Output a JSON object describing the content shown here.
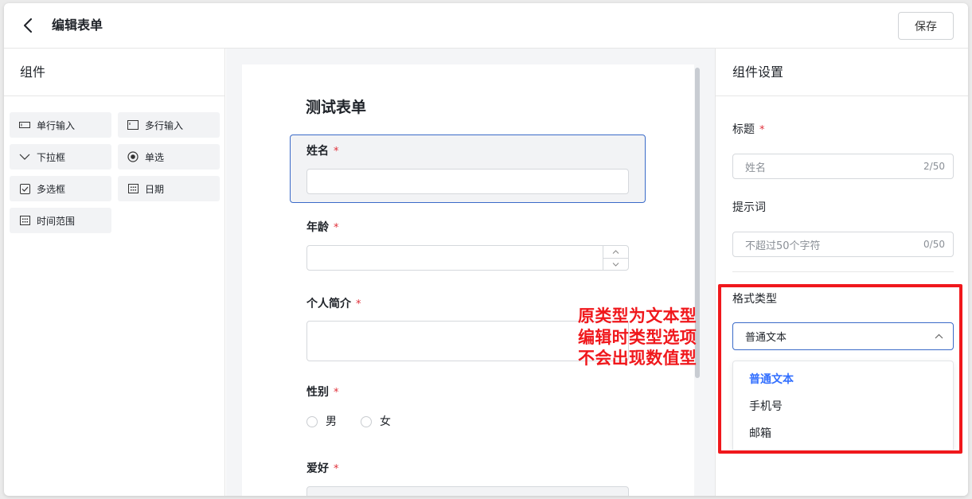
{
  "header": {
    "back_icon": "chevron-left-icon",
    "title": "编辑表单",
    "save_label": "保存"
  },
  "left_panel": {
    "title": "组件",
    "components": [
      {
        "label": "单行输入",
        "icon": "single-line-input-icon"
      },
      {
        "label": "多行输入",
        "icon": "multi-line-input-icon"
      },
      {
        "label": "下拉框",
        "icon": "chevron-down-icon"
      },
      {
        "label": "单选",
        "icon": "radio-icon"
      },
      {
        "label": "多选框",
        "icon": "checkbox-icon"
      },
      {
        "label": "日期",
        "icon": "calendar-icon"
      },
      {
        "label": "时间范围",
        "icon": "calendar-icon"
      }
    ]
  },
  "form": {
    "title": "测试表单",
    "fields": [
      {
        "label": "姓名",
        "required": "*"
      },
      {
        "label": "年龄",
        "required": "*"
      },
      {
        "label": "个人简介",
        "required": "*"
      },
      {
        "label": "性别",
        "required": "*",
        "options": [
          "男",
          "女"
        ]
      },
      {
        "label": "爱好",
        "required": "*"
      }
    ]
  },
  "annotation": {
    "lines": [
      "原类型为文本型",
      "编辑时类型选项",
      "不会出现数值型"
    ],
    "color": "#f0181c"
  },
  "settings": {
    "title": "组件设置",
    "title_label": "标题",
    "title_required": "*",
    "title_placeholder": "姓名",
    "title_count": "2/50",
    "hint_label": "提示词",
    "hint_placeholder": "不超过50个字符",
    "hint_count": "0/50",
    "format_label": "格式类型",
    "format_value": "普通文本",
    "format_options": [
      "普通文本",
      "手机号",
      "邮箱"
    ]
  },
  "colors": {
    "accent": "#3370ff",
    "selected_border": "#3a6ac8",
    "required": "#e0303a"
  }
}
